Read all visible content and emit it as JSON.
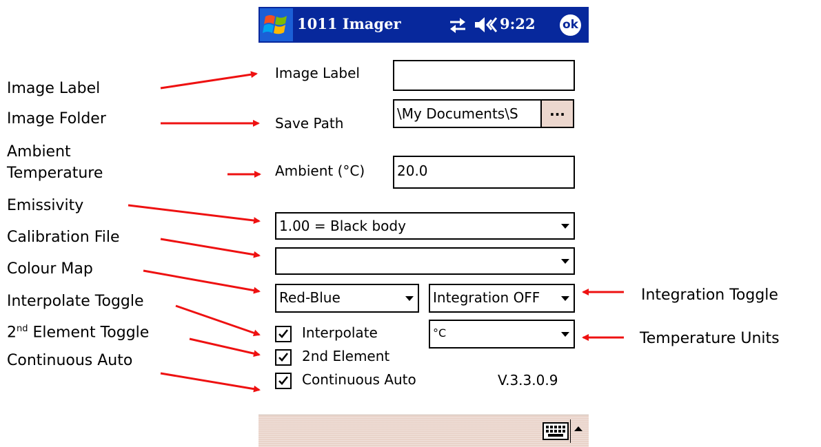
{
  "window": {
    "title": "1011 Imager",
    "clock": "9:22",
    "ok_label": "ok",
    "colors": {
      "titlebar": "#07289c",
      "bottombar": "#e9d3c9",
      "arrow": "#ee1111",
      "browse_button": "#ecd7ce"
    }
  },
  "form": {
    "image_label": {
      "label": "Image Label",
      "value": ""
    },
    "save_path": {
      "label": "Save Path",
      "value": "\\My Documents\\S",
      "browse_label": "..."
    },
    "ambient": {
      "label": "Ambient (°C)",
      "value": "20.0"
    },
    "emissivity": {
      "selected": "1.00 = Black body"
    },
    "calibration": {
      "selected": ""
    },
    "colour_map": {
      "selected": "Red-Blue"
    },
    "integration": {
      "selected": "Integration OFF"
    },
    "units": {
      "selected": "°C"
    },
    "interpolate": {
      "label": "Interpolate",
      "checked": true
    },
    "second_element": {
      "label": "2nd Element",
      "checked": true
    },
    "continuous_auto": {
      "label": "Continuous Auto",
      "checked": true
    },
    "version": "V.3.3.0.9"
  },
  "annotations": {
    "image_label": "Image Label",
    "image_folder": "Image Folder",
    "ambient_line1": "Ambient",
    "ambient_line2": "Temperature",
    "emissivity": "Emissivity",
    "calibration_file": "Calibration File",
    "colour_map": "Colour Map",
    "interpolate_toggle": "Interpolate Toggle",
    "second_element_prefix": "2",
    "second_element_sup": "nd",
    "second_element_suffix": " Element Toggle",
    "continuous_auto": "Continuous Auto",
    "integration_toggle": "Integration Toggle",
    "temperature_units": "Temperature Units"
  }
}
